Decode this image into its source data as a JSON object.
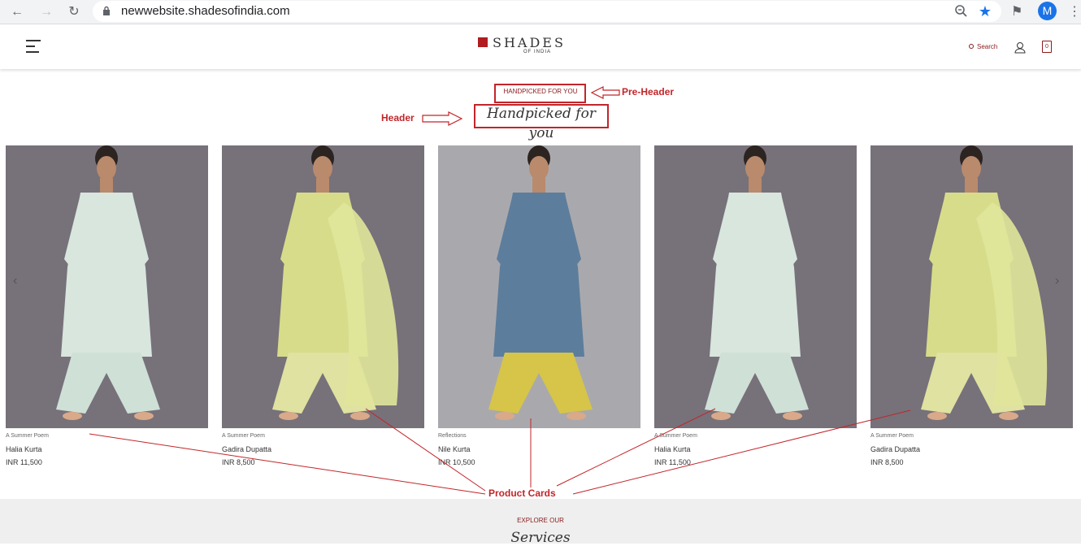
{
  "browser": {
    "url": "newwebsite.shadesofindia.com",
    "profile_initial": "M",
    "accent": "#1a73e8"
  },
  "site": {
    "logo_name": "SHADES",
    "logo_sub": "OF INDIA",
    "search_label": "Search",
    "cart_count": "0",
    "brand_color": "#b01c1f"
  },
  "section": {
    "preheader": "HANDPICKED FOR YOU",
    "header": "Handpicked for you"
  },
  "annotations": {
    "preheader": "Pre-Header",
    "header": "Header",
    "product_cards": "Product Cards",
    "color": "#c2252a"
  },
  "products": [
    {
      "collection": "A Summer Poem",
      "name": "Halia Kurta",
      "price": "INR 11,500",
      "look": "mint"
    },
    {
      "collection": "A Summer Poem",
      "name": "Gadira Dupatta",
      "price": "INR 8,500",
      "look": "yellow"
    },
    {
      "collection": "Reflections",
      "name": "Nile Kurta",
      "price": "INR 10,500",
      "look": "blue"
    },
    {
      "collection": "A Summer Poem",
      "name": "Halia Kurta",
      "price": "INR 11,500",
      "look": "mint"
    },
    {
      "collection": "A Summer Poem",
      "name": "Gadira Dupatta",
      "price": "INR 8,500",
      "look": "yellow"
    }
  ],
  "services": {
    "preheader": "EXPLORE OUR",
    "title": "Services"
  }
}
